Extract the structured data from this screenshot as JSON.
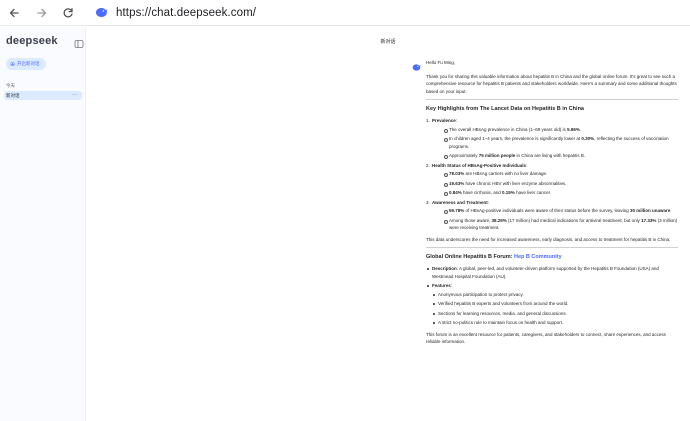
{
  "browser": {
    "url": "https://chat.deepseek.com/"
  },
  "sidebar": {
    "logo": "deepseek",
    "new_chat": "开启新对话",
    "section": "今天",
    "chat_item": "新对话",
    "chat_more": "···"
  },
  "main": {
    "title": "新对话",
    "greeting": "Hello Fu Ming,",
    "intro": "Thank you for sharing this valuable information about hepatitis B in China and the global online forum. It's great to see such a comprehensive resource for hepatitis B patients and stakeholders worldwide. Here's a summary and some additional thoughts based on your input:",
    "h1": "Key Highlights from The Lancet Data on Hepatitis B in China",
    "s1": {
      "head": "Prevalence",
      "b1_pre": "The overall HBsAg prevalence in China (1–69 years old) is ",
      "b1_bold": "5.86%",
      "b1_post": ".",
      "b2_pre": "In children aged 1–4 years, the prevalence is significantly lower at ",
      "b2_bold": "0.30%",
      "b2_post": ", reflecting the success of vaccination programs.",
      "b3_pre": "Approximately ",
      "b3_bold": "75 million people",
      "b3_post": " in China are living with hepatitis B."
    },
    "s2": {
      "head": "Health Status of HBsAg-Positive Individuals",
      "b1_bold": "78.03%",
      "b1_post": " are HBsAg carriers with no liver damage.",
      "b2_bold": "19.63%",
      "b2_post": " have chronic HBV with liver enzyme abnormalities.",
      "b3_bold": "0.84%",
      "b3_mid": " have cirrhosis, and ",
      "b3_bold2": "0.15%",
      "b3_post": " have liver cancer."
    },
    "s3": {
      "head": "Awareness and Treatment",
      "b1_bold": "59.78%",
      "b1_mid": " of HBsAg-positive individuals were aware of their status before the survey, leaving ",
      "b1_bold2": "30 million unaware",
      "b1_post": ".",
      "b2_pre": "Among those aware, ",
      "b2_bold": "38.25%",
      "b2_mid": " (17 million) had medical indications for antiviral treatment, but only ",
      "b2_bold2": "17.33%",
      "b2_post": " (3 million) were receiving treatment."
    },
    "summary1": "This data underscores the need for increased awareness, early diagnosis, and access to treatment for hepatitis B in China.",
    "h2_pre": "Global Online Hepatitis B Forum: ",
    "h2_link": "Hep B Community",
    "desc_head": "Description",
    "desc_text": ": A global, peer-led, and volunteer-driven platform supported by the Hepatitis B Foundation (USA) and Westmead Hospital Foundation (AU).",
    "feat_head": "Features",
    "features": [
      "Anonymous participation to protect privacy.",
      "Verified hepatitis B experts and volunteers from around the world.",
      "Sections for learning resources, media, and general discussions.",
      "A strict no-politics rule to maintain focus on health and support."
    ],
    "summary2": "This forum is an excellent resource for patients, caregivers, and stakeholders to connect, share experiences, and access reliable information."
  }
}
